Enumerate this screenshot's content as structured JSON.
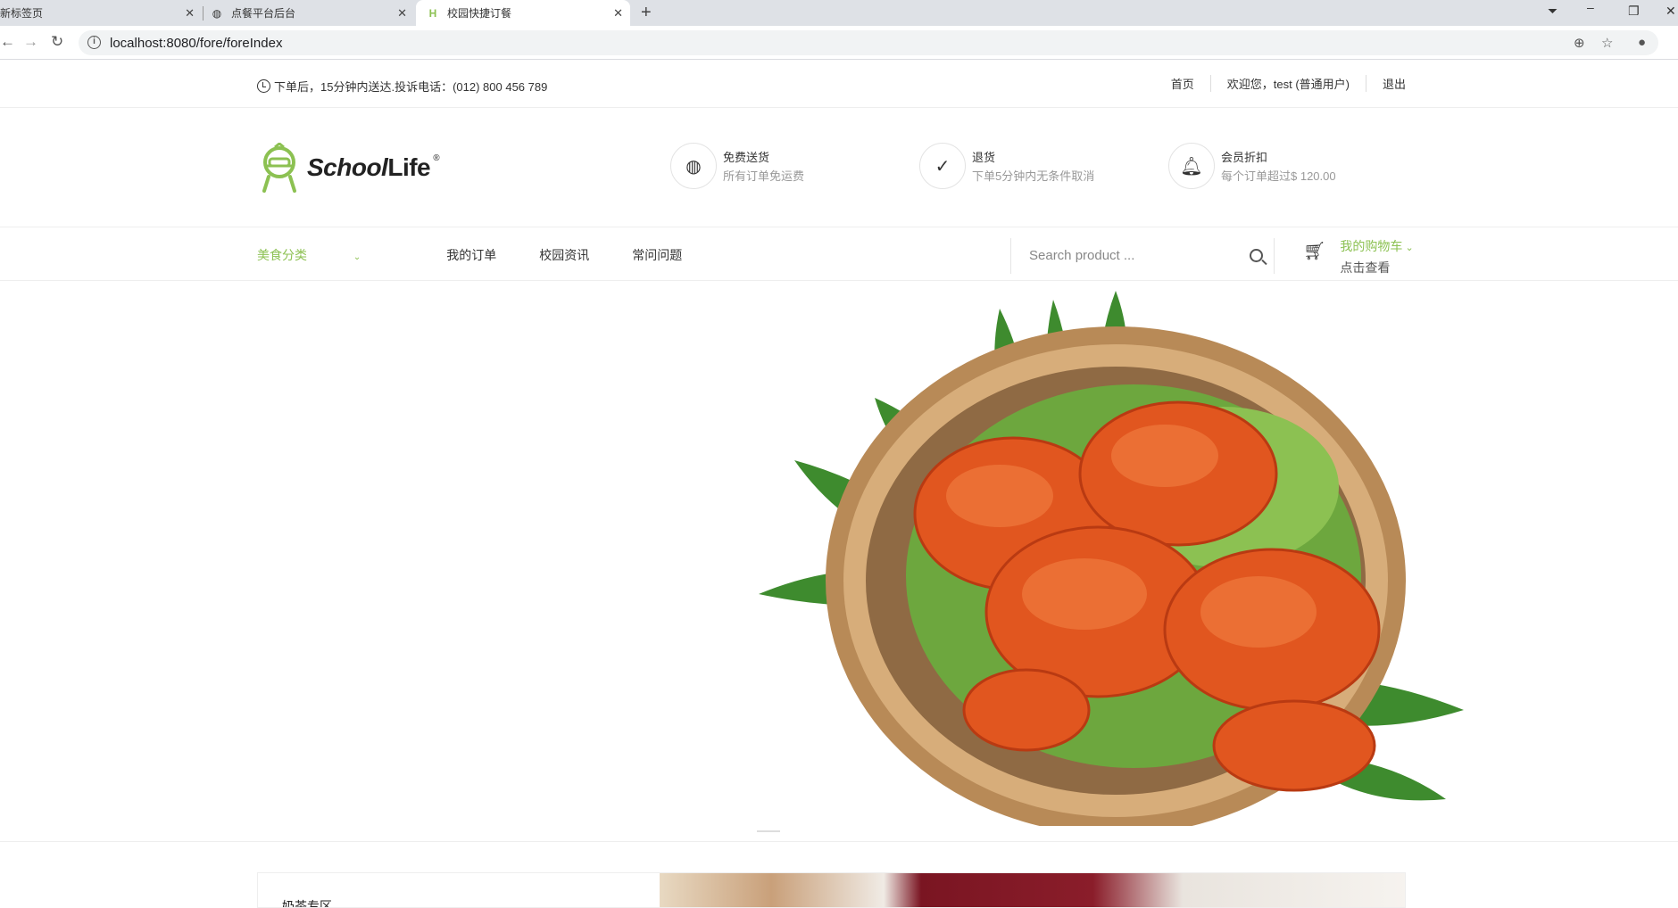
{
  "browser": {
    "tabs": [
      {
        "title": "新标签页"
      },
      {
        "title": "点餐平台后台"
      },
      {
        "title": "校园快捷订餐"
      }
    ],
    "url": "localhost:8080/fore/foreIndex"
  },
  "topbar": {
    "notice": "下单后，15分钟内送达.投诉电话：(012) 800 456 789",
    "links": [
      "首页",
      "欢迎您，test (普通用户)",
      "退出"
    ]
  },
  "header": {
    "logo_text_1": "School",
    "logo_text_2": "Life",
    "logo_mark": "®",
    "features": [
      {
        "icon": "globe-icon",
        "title": "免费送货",
        "subtitle": "所有订单免运费"
      },
      {
        "icon": "check-circle-icon",
        "title": "退货",
        "subtitle": "下单5分钟内无条件取消"
      },
      {
        "icon": "bell-icon",
        "title": "会员折扣",
        "subtitle": "每个订单超过$ 120.00"
      }
    ]
  },
  "nav": {
    "items": [
      "美食分类",
      "我的订单",
      "校园资讯",
      "常问问题"
    ],
    "search_placeholder": "Search product ...",
    "cart_title": "我的购物车",
    "cart_sub": "点击查看"
  },
  "section": {
    "title": "奶茶专区"
  },
  "colors": {
    "accent": "#8cc152"
  }
}
